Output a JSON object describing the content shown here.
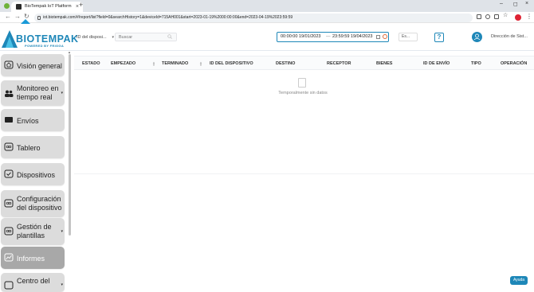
{
  "browser": {
    "tab_title": "BioTempak IoT Platform",
    "url": "iot.biotempak.com/#/report/list?field=0&searchHistory=1&deviceId=715AH001&start=2023-01-19%2000:00:00&end=2023-04-19%2023:59:59"
  },
  "header": {
    "brand": "BIOTEMPAK",
    "tagline": "POWERED BY FRIGGA",
    "device_select": "ID del disposi...",
    "search_placeholder": "Buscar",
    "date_start": "00:00:00 19/01/2023",
    "date_sep": "—",
    "date_end": "23:59:59 19/04/2023",
    "lang": "Es...",
    "help": "?",
    "user": "Dirección de Sist..."
  },
  "sidebar": {
    "items": [
      {
        "label": "Visión general"
      },
      {
        "label1": "Monitoreo en",
        "label2": "tiempo real"
      },
      {
        "label": "Envíos"
      },
      {
        "label": "Tablero"
      },
      {
        "label": "Dispositivos"
      },
      {
        "label1": "Configuración",
        "label2": "del dispositivo"
      },
      {
        "label1": "Gestión de",
        "label2": "plantillas"
      },
      {
        "label": "Informes"
      },
      {
        "label1": "Centro del",
        "label2": ""
      }
    ]
  },
  "table": {
    "columns": [
      "ESTADO",
      "EMPEZADO",
      "TERMINADO",
      "ID DEL DISPOSITIVO",
      "DESTINO",
      "RECEPTOR",
      "BIENES",
      "ID DE ENVÍO",
      "TIPO",
      "OPERACIÓN"
    ],
    "empty_text": "Temporalmente sin datos"
  },
  "help_chip": "Ayuda",
  "colors": {
    "brand": "#1e87b8",
    "active_nav": "#a8a8a8",
    "nav_bg": "#dcdcdc"
  }
}
